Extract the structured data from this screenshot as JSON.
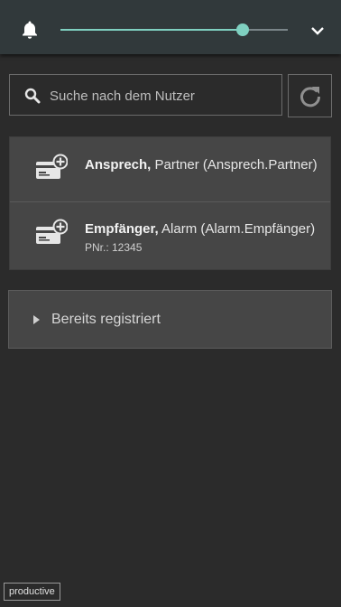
{
  "header": {
    "bell_icon": "bell-icon",
    "slider_value_fraction": 0.8,
    "chevron_icon": "chevron-down-icon",
    "accent_color": "#7fd0c0"
  },
  "search": {
    "placeholder": "Suche nach dem Nutzer",
    "value": "",
    "icon": "search-icon",
    "refresh_icon": "refresh-icon"
  },
  "users": [
    {
      "name": "Ansprech,",
      "rest": " Partner (Ansprech.Partner)",
      "pnr": ""
    },
    {
      "name": "Empfänger,",
      "rest": " Alarm (Alarm.Empfänger)",
      "pnr": "PNr.: 12345"
    }
  ],
  "registered": {
    "label": "Bereits registriert",
    "expanded": false
  },
  "environment_badge": "productive"
}
